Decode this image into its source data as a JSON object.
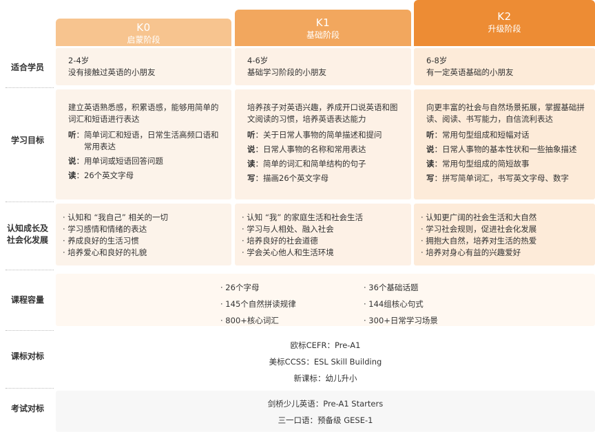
{
  "levels": [
    {
      "code": "K0",
      "stage": "启蒙阶段"
    },
    {
      "code": "K1",
      "stage": "基础阶段"
    },
    {
      "code": "K2",
      "stage": "升级阶段"
    }
  ],
  "rows": {
    "learners": {
      "label": "适合学员",
      "cells": [
        {
          "age": "2-4岁",
          "desc": "没有接触过英语的小朋友"
        },
        {
          "age": "4-6岁",
          "desc": "基础学习阶段的小朋友"
        },
        {
          "age": "6-8岁",
          "desc": "有一定英语基础的小朋友"
        }
      ]
    },
    "goals": {
      "label": "学习目标",
      "cells": [
        {
          "intro": "建立英语熟悉感，积累语感，能够用简单的词汇和短语进行表达",
          "items": [
            {
              "key": "听",
              "text": "简单词汇和短语，日常生活高频口语和常用表达"
            },
            {
              "key": "说",
              "text": "用单词或短语回答问题"
            },
            {
              "key": "读",
              "text": "26个英文字母"
            }
          ]
        },
        {
          "intro": "培养孩子对英语兴趣，养成开口说英语和图文阅读的习惯，培养英语表达能力",
          "items": [
            {
              "key": "听",
              "text": "关于日常人事物的简单描述和提问"
            },
            {
              "key": "说",
              "text": "日常人事物的名称和常用表达"
            },
            {
              "key": "读",
              "text": "简单的词汇和简单结构的句子"
            },
            {
              "key": "写",
              "text": "描画26个英文字母"
            }
          ]
        },
        {
          "intro": "向更丰富的社会与自然场景拓展，掌握基础拼读、阅读、书写能力，自信流利表达",
          "items": [
            {
              "key": "听",
              "text": "常用句型组成和短幅对话"
            },
            {
              "key": "说",
              "text": "日常人事物的基本性状和一些抽象描述"
            },
            {
              "key": "读",
              "text": "常用句型组成的简短故事"
            },
            {
              "key": "写",
              "text": "拼写简单词汇，书写英文字母、数字"
            }
          ]
        }
      ]
    },
    "growth": {
      "label_line1": "认知成长及",
      "label_line2": "社会化发展",
      "cells": [
        [
          "· 认知和 “我自己” 相关的一切",
          "· 学习感情和情绪的表达",
          "· 养成良好的生活习惯",
          "· 培养爱心和良好的礼貌"
        ],
        [
          "· 认知 “我” 的家庭生活和社会生活",
          "· 学习与人相处、融入社会",
          "· 培养良好的社会道德",
          "· 学会关心他人和生活环境"
        ],
        [
          "· 认知更广阔的社会生活和大自然",
          "· 学习社会规则，促进社会化发展",
          "· 拥抱大自然，培养对生活的热爱",
          "· 培养对身心有益的兴趣爱好"
        ]
      ]
    },
    "capacity": {
      "label": "课程容量",
      "left": [
        "· 26个字母",
        "· 145个自然拼读规律",
        "· 800+核心词汇"
      ],
      "right": [
        "· 36个基础话题",
        "· 144组核心句式",
        "· 300+日常学习场景"
      ]
    },
    "standards": {
      "label": "课标对标",
      "lines": [
        {
          "k": "欧标CEFR：",
          "v": "Pre-A1"
        },
        {
          "k": "美标CCSS：",
          "v": "ESL Skill Building"
        },
        {
          "k": "新课标：",
          "v": "幼儿升小"
        }
      ]
    },
    "exams": {
      "label": "考试对标",
      "lines": [
        {
          "k": "剑桥少儿英语：",
          "v": "Pre-A1 Starters"
        },
        {
          "k": "三一口语：",
          "v": "预备级 GESE-1"
        }
      ]
    }
  },
  "colors": {
    "k0": "#f7c48f",
    "k1": "#f2a75e",
    "k2": "#ed8c34"
  }
}
